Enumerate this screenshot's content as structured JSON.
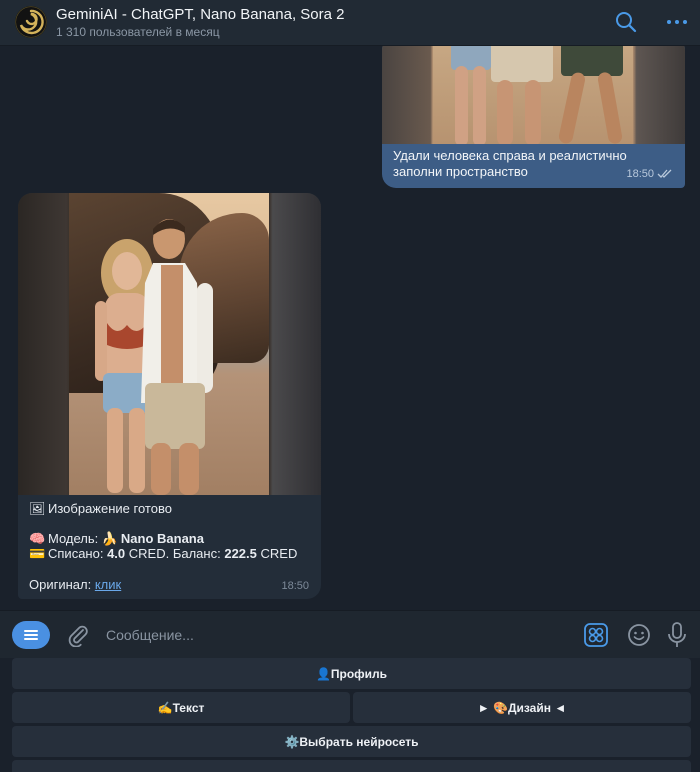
{
  "header": {
    "title": "GeminiAI - ChatGPT, Nano Banana, Sora 2",
    "subtitle": "1 310 пользователей в месяц"
  },
  "messages": {
    "outgoing": {
      "text": "Удали человека справа и реалистично заполни пространство",
      "time": "18:50"
    },
    "incoming": {
      "ready_emoji": "🖼",
      "ready_text": "Изображение готово",
      "model_emoji": "🧠",
      "model_label": "Модель:",
      "banana_emoji": "🍌",
      "model_name": "Nano Banana",
      "card_emoji": "💳",
      "charged_label": "Списано:",
      "charged_value": "4.0",
      "cred_label_1": "CRED. Баланс:",
      "balance_value": "222.5",
      "cred_label_2": "CRED",
      "original_label": "Оригинал:",
      "original_link": "клик",
      "time": "18:50"
    }
  },
  "composer": {
    "placeholder": "Сообщение..."
  },
  "keyboard": {
    "profile": "👤Профиль",
    "text": "✍️Текст",
    "design": "► 🎨Дизайн ◄",
    "choose_model": "⚙️Выбрать нейросеть"
  },
  "colors": {
    "accent": "#4a90e2",
    "outgoing_bubble": "#3d5d86",
    "incoming_bubble": "#232d39",
    "link": "#6aa8ea"
  }
}
